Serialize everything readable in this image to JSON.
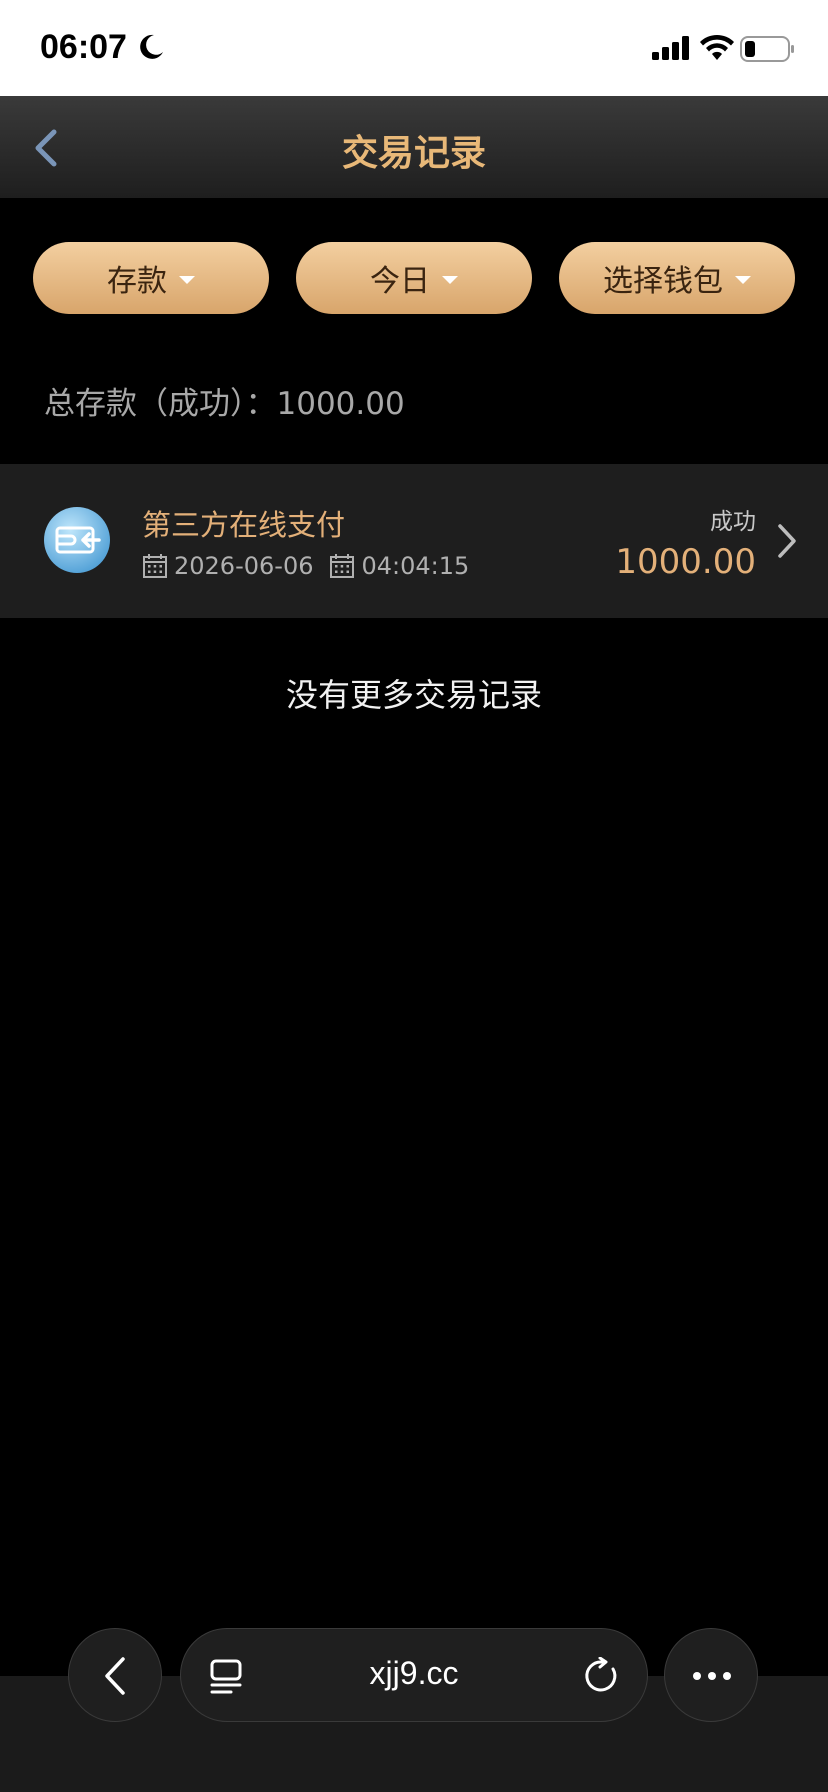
{
  "status_bar": {
    "time": "06:07"
  },
  "header": {
    "title": "交易记录"
  },
  "filters": [
    {
      "label": "存款"
    },
    {
      "label": "今日"
    },
    {
      "label": "选择钱包"
    }
  ],
  "summary": {
    "label": "总存款（成功）：",
    "amount": "1000.00"
  },
  "records": [
    {
      "title": "第三方在线支付",
      "date": "2026-06-06",
      "time": "04:04:15",
      "status": "成功",
      "amount": "1000.00"
    }
  ],
  "footer_text": "没有更多交易记录",
  "browser": {
    "url": "xjj9.cc"
  },
  "colors": {
    "accent": "#e3b079",
    "button_gradient_top": "#f3cfa0",
    "button_gradient_bottom": "#d8a56b",
    "background": "#000000"
  }
}
